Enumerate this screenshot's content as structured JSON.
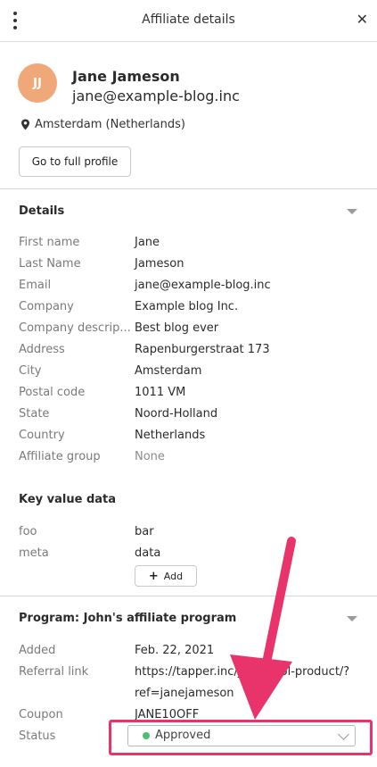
{
  "header": {
    "title": "Affiliate details",
    "close_glyph": "✕"
  },
  "profile": {
    "initials": "JJ",
    "name": "Jane Jameson",
    "email": "jane@example-blog.inc",
    "location": "Amsterdam (Netherlands)",
    "full_profile_label": "Go to full profile",
    "avatar_color": "#f0a878"
  },
  "details": {
    "title": "Details",
    "rows": [
      {
        "label": "First name",
        "value": "Jane"
      },
      {
        "label": "Last Name",
        "value": "Jameson"
      },
      {
        "label": "Email",
        "value": "jane@example-blog.inc"
      },
      {
        "label": "Company",
        "value": "Example blog Inc."
      },
      {
        "label": "Company descrip...",
        "value": "Best blog ever"
      },
      {
        "label": "Address",
        "value": "Rapenburgerstraat 173"
      },
      {
        "label": "City",
        "value": "Amsterdam"
      },
      {
        "label": "Postal code",
        "value": "1011 VM"
      },
      {
        "label": "State",
        "value": "Noord-Holland"
      },
      {
        "label": "Country",
        "value": "Netherlands"
      },
      {
        "label": "Affiliate group",
        "value": "None"
      }
    ]
  },
  "key_value": {
    "title": "Key value data",
    "rows": [
      {
        "label": "foo",
        "value": "bar"
      },
      {
        "label": "meta",
        "value": "data"
      }
    ],
    "add_label": "Add"
  },
  "program": {
    "title": "Program: John's affiliate program",
    "added_label": "Added",
    "added_value": "Feb. 22, 2021",
    "referral_label": "Referral link",
    "referral_line1": "https://tapper.inc/john-cool-product/?",
    "referral_line2": "ref=janejameson",
    "coupon_label": "Coupon",
    "coupon_value": "JANE10OFF",
    "status_label": "Status",
    "status_value": "Approved",
    "status_color": "#4cbf72"
  },
  "annotation": {
    "color": "#e8336b"
  }
}
